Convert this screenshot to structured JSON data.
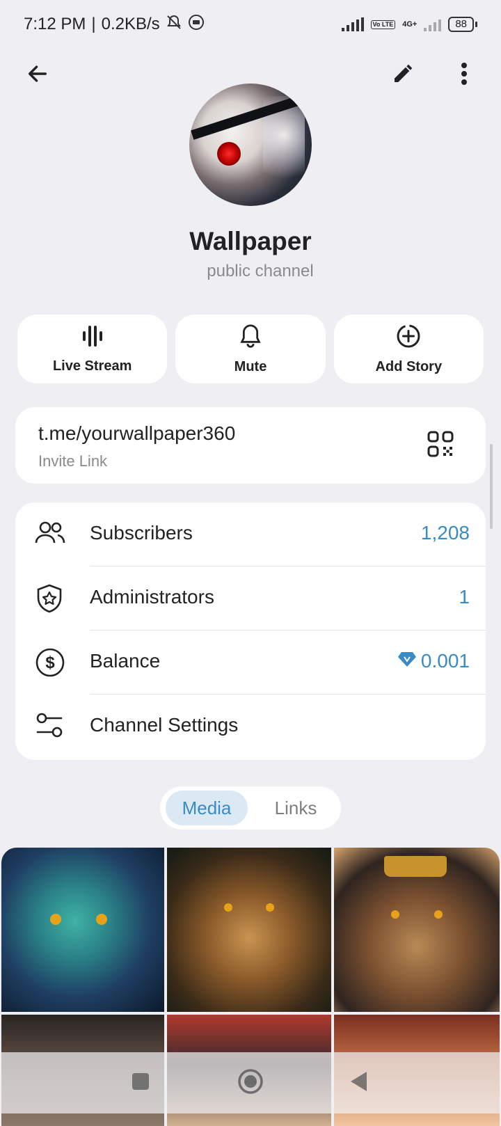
{
  "status_bar": {
    "time": "7:12 PM",
    "separator": "|",
    "speed": "0.2KB/s",
    "network": "4G+",
    "volte": "Vo LTE",
    "battery": "88"
  },
  "toolbar": {
    "back_icon": "arrow-left-icon",
    "edit_icon": "pencil-icon",
    "more_icon": "more-vertical-icon"
  },
  "channel": {
    "name": "Wallpaper",
    "type": "public channel"
  },
  "actions": [
    {
      "label": "Live Stream",
      "icon": "live-stream-icon"
    },
    {
      "label": "Mute",
      "icon": "bell-icon"
    },
    {
      "label": "Add Story",
      "icon": "add-story-icon"
    }
  ],
  "invite": {
    "url": "t.me/yourwallpaper360",
    "label": "Invite Link",
    "icon": "qr-code-icon"
  },
  "info_rows": [
    {
      "label": "Subscribers",
      "value": "1,208",
      "icon": "users-icon"
    },
    {
      "label": "Administrators",
      "value": "1",
      "icon": "shield-star-icon"
    },
    {
      "label": "Balance",
      "value": "0.001",
      "icon": "dollar-circle-icon"
    },
    {
      "label": "Channel Settings",
      "value": "",
      "icon": "sliders-icon"
    }
  ],
  "tabs": {
    "media": "Media",
    "links": "Links",
    "selected": "Media"
  },
  "colors": {
    "accent": "#3a8bc4",
    "background": "#efeff3",
    "card": "#ffffff",
    "tab_selected_bg": "#dbe9f5"
  },
  "media_grid": [
    {
      "subject": "dragon"
    },
    {
      "subject": "lion"
    },
    {
      "subject": "crowned lion"
    },
    {
      "subject": "warrior"
    },
    {
      "subject": "pirate"
    },
    {
      "subject": "fighter"
    }
  ],
  "nav_bar": {
    "recents_icon": "square-icon",
    "home_icon": "circle-icon",
    "back_icon": "triangle-back-icon"
  }
}
